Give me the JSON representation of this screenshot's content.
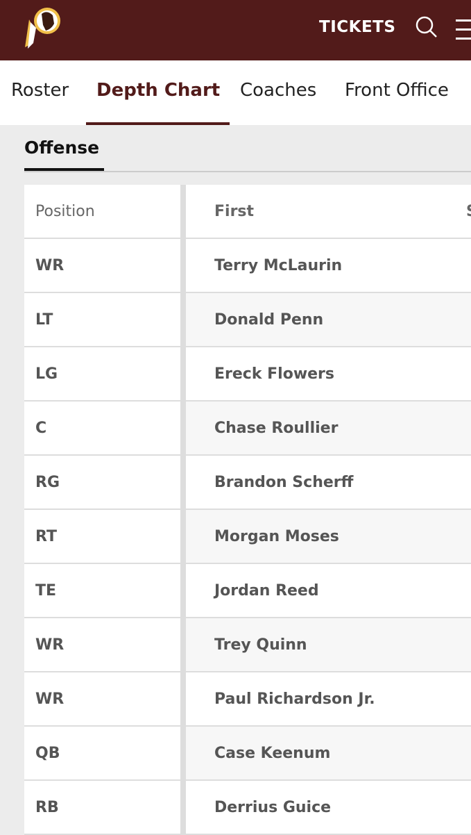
{
  "header": {
    "tickets_label": "TICKETS",
    "brand_color": "#521b1a"
  },
  "tabs": [
    {
      "label": "Roster"
    },
    {
      "label": "Depth Chart",
      "active": true
    },
    {
      "label": "Coaches"
    },
    {
      "label": "Front Office"
    }
  ],
  "section": {
    "title": "Offense"
  },
  "table": {
    "columns": [
      "Position",
      "First",
      "S"
    ],
    "rows": [
      {
        "position": "WR",
        "first": "Terry McLaurin"
      },
      {
        "position": "LT",
        "first": "Donald Penn"
      },
      {
        "position": "LG",
        "first": "Ereck Flowers"
      },
      {
        "position": "C",
        "first": "Chase Roullier"
      },
      {
        "position": "RG",
        "first": "Brandon Scherff"
      },
      {
        "position": "RT",
        "first": "Morgan Moses"
      },
      {
        "position": "TE",
        "first": "Jordan Reed"
      },
      {
        "position": "WR",
        "first": "Trey Quinn"
      },
      {
        "position": "WR",
        "first": "Paul Richardson Jr."
      },
      {
        "position": "QB",
        "first": "Case Keenum"
      },
      {
        "position": "RB",
        "first": "Derrius Guice"
      }
    ]
  }
}
